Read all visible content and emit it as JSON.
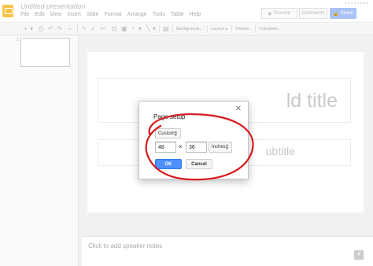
{
  "app": {
    "doc_title": "Untitled presentation",
    "menu": [
      "File",
      "Edit",
      "View",
      "Insert",
      "Slide",
      "Format",
      "Arrange",
      "Tools",
      "Table",
      "Help"
    ],
    "buttons": {
      "present": "Present",
      "comments": "Comments",
      "share": "Share"
    },
    "brand_color": "#f6c447",
    "share_color": "#a9c3f5"
  },
  "toolbar": {
    "background_label": "Background...",
    "layout_label": "Layout",
    "theme_label": "Theme...",
    "transition_label": "Transition..."
  },
  "filmstrip": {
    "slide_number": "1"
  },
  "slide": {
    "title_placeholder": "ld title",
    "subtitle_placeholder": "ubtitle"
  },
  "notes": {
    "placeholder": "Click to add speaker notes"
  },
  "dialog": {
    "title": "Page setup",
    "close_icon": "close-icon",
    "size_preset": "Custom",
    "width_value": "48",
    "times_symbol": "×",
    "height_value": "36",
    "units": "Inches",
    "ok_label": "OK",
    "cancel_label": "Cancel",
    "ok_color": "#4d90fe"
  },
  "annotation": {
    "stroke_color": "#d7191c"
  }
}
